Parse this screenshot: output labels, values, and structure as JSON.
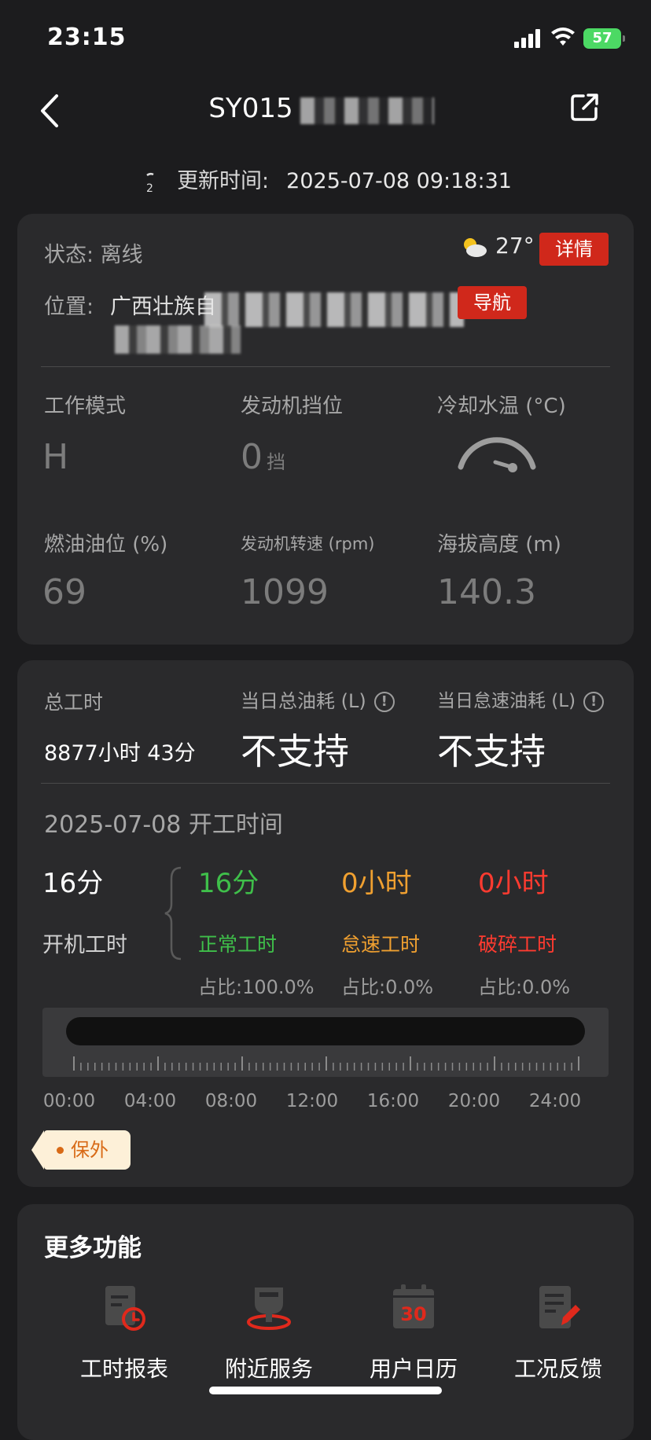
{
  "status_bar": {
    "time": "23:15",
    "battery": "57"
  },
  "header": {
    "title": "SY015"
  },
  "update": {
    "icon_text": "2",
    "label": "更新时间:",
    "value": "2025-07-08 09:18:31"
  },
  "status_card": {
    "status_label": "状态: 离线",
    "weather_temp": "27°",
    "detail_button": "详情",
    "location_label": "位置:",
    "location_value": "广西壮族自",
    "nav_button": "导航",
    "metrics": [
      {
        "label": "工作模式",
        "value": "H",
        "unit": ""
      },
      {
        "label": "发动机挡位",
        "value": "0",
        "unit": "挡"
      },
      {
        "label": "冷却水温 (°C)",
        "value": "",
        "unit": ""
      },
      {
        "label": "燃油油位 (%)",
        "value": "69",
        "unit": ""
      },
      {
        "label": "发动机转速 (rpm)",
        "value": "1099",
        "unit": ""
      },
      {
        "label": "海拔高度 (m)",
        "value": "140.3",
        "unit": ""
      }
    ]
  },
  "work_card": {
    "total_hours_label": "总工时",
    "total_hours_value": "8877小时 43分",
    "daily_fuel_label": "当日总油耗 (L)",
    "daily_fuel_value": "不支持",
    "idle_fuel_label": "当日怠速油耗 (L)",
    "idle_fuel_value": "不支持",
    "date_title": "2025-07-08 开工时间",
    "on_time_value": "16分",
    "on_time_label": "开机工时",
    "normal": {
      "value": "16分",
      "label": "正常工时",
      "ratio": "占比:100.0%"
    },
    "idle": {
      "value": "0小时",
      "label": "怠速工时",
      "ratio": "占比:0.0%"
    },
    "break": {
      "value": "0小时",
      "label": "破碎工时",
      "ratio": "占比:0.0%"
    },
    "timeline_ticks": [
      "00:00",
      "04:00",
      "08:00",
      "12:00",
      "16:00",
      "20:00",
      "24:00"
    ],
    "warranty_badge": "保外"
  },
  "more": {
    "title": "更多功能",
    "items": [
      {
        "label": "工时报表",
        "icon": "hours-report-icon"
      },
      {
        "label": "附近服务",
        "icon": "nearby-service-icon"
      },
      {
        "label": "用户日历",
        "icon": "user-calendar-icon",
        "icon_text": "30"
      },
      {
        "label": "工况反馈",
        "icon": "condition-feedback-icon"
      }
    ]
  },
  "colors": {
    "accent_red": "#d0281b",
    "green": "#3fbf4a",
    "orange": "#f0a030",
    "red": "#ff3b30"
  }
}
